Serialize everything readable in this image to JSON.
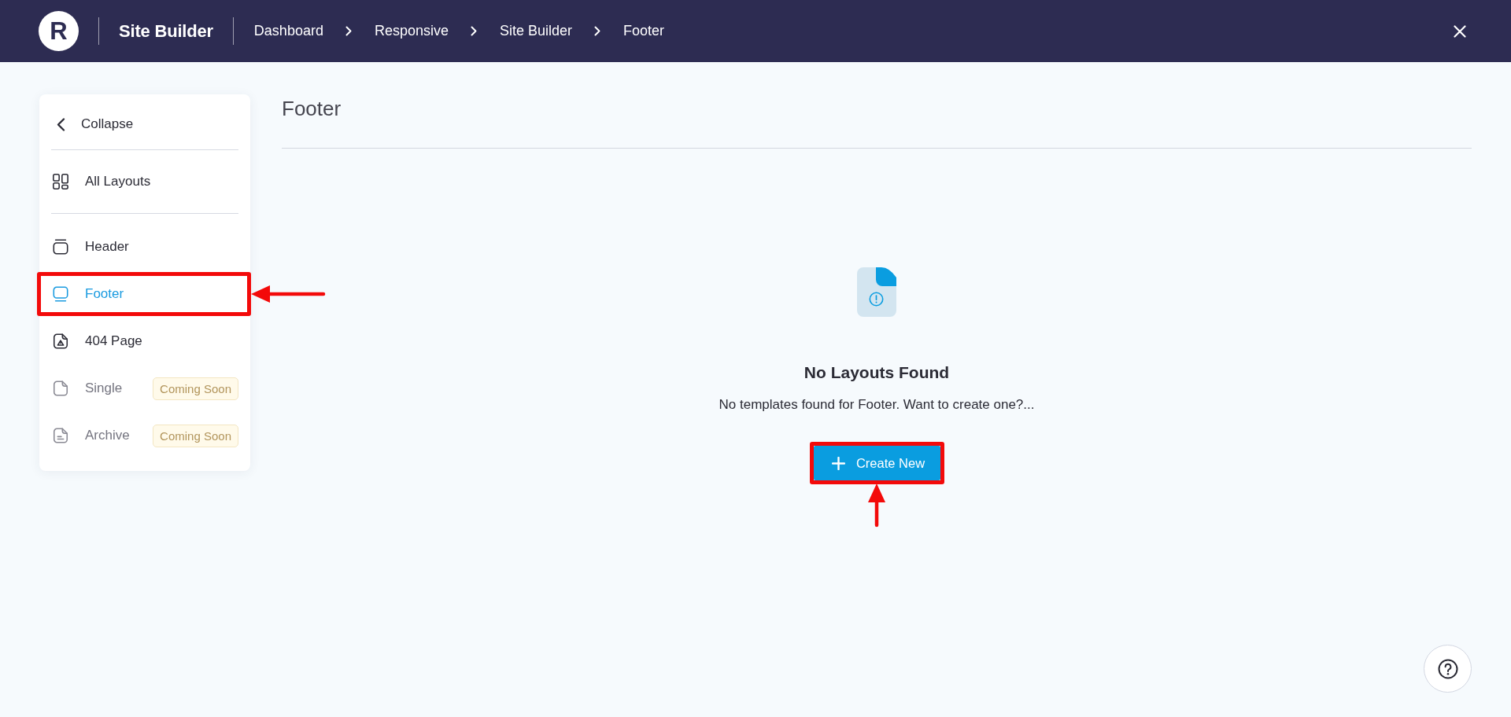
{
  "topbar": {
    "logo": "R",
    "app_title": "Site Builder",
    "breadcrumbs": [
      "Dashboard",
      "Responsive",
      "Site Builder",
      "Footer"
    ]
  },
  "sidebar": {
    "collapse_label": "Collapse",
    "all_layouts": {
      "label": "All Layouts",
      "selected": false
    },
    "items": [
      {
        "kind": "header",
        "label": "Header",
        "selected": false,
        "disabled": false,
        "highlighted": false
      },
      {
        "kind": "footer",
        "label": "Footer",
        "selected": true,
        "disabled": false,
        "highlighted": true
      },
      {
        "kind": "error-page",
        "label": "404 Page",
        "selected": false,
        "disabled": false,
        "highlighted": false
      },
      {
        "kind": "single",
        "label": "Single",
        "selected": false,
        "disabled": true,
        "highlighted": false,
        "badge": "Coming Soon"
      },
      {
        "kind": "archive",
        "label": "Archive",
        "selected": false,
        "disabled": true,
        "highlighted": false,
        "badge": "Coming Soon"
      }
    ]
  },
  "main": {
    "title": "Footer",
    "empty_state": {
      "title": "No Layouts Found",
      "message": "No templates found for Footer. Want to create one?...",
      "button": {
        "label": "Create New",
        "highlighted": true
      }
    }
  }
}
